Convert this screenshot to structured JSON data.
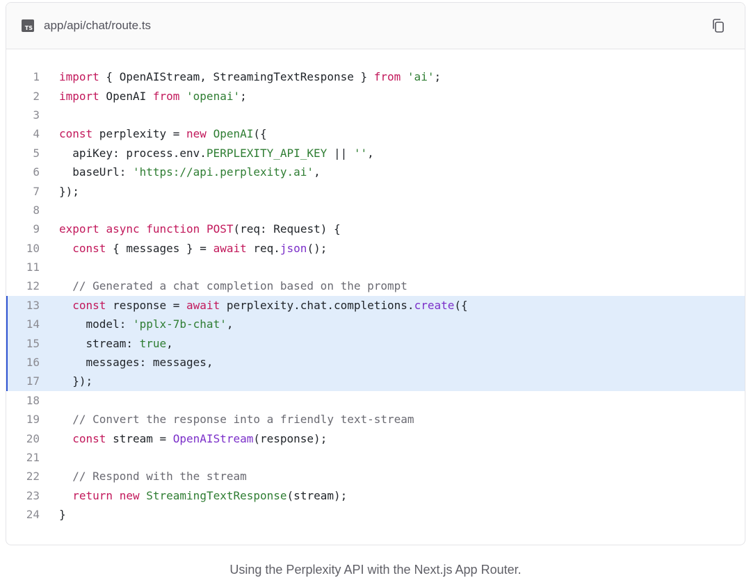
{
  "file": {
    "badge": "TS",
    "name": "app/api/chat/route.ts"
  },
  "copy_icon": "copy-icon",
  "highlight_lines": [
    13,
    14,
    15,
    16,
    17
  ],
  "code_lines": [
    {
      "n": "1",
      "tokens": [
        [
          "kw",
          "import"
        ],
        [
          "p",
          " { OpenAIStream, StreamingTextResponse } "
        ],
        [
          "kw",
          "from"
        ],
        [
          "p",
          " "
        ],
        [
          "str",
          "'ai'"
        ],
        [
          "p",
          ";"
        ]
      ]
    },
    {
      "n": "2",
      "tokens": [
        [
          "kw",
          "import"
        ],
        [
          "p",
          " OpenAI "
        ],
        [
          "kw",
          "from"
        ],
        [
          "p",
          " "
        ],
        [
          "str",
          "'openai'"
        ],
        [
          "p",
          ";"
        ]
      ]
    },
    {
      "n": "3",
      "tokens": []
    },
    {
      "n": "4",
      "tokens": [
        [
          "kw",
          "const"
        ],
        [
          "p",
          " perplexity = "
        ],
        [
          "kw",
          "new"
        ],
        [
          "p",
          " "
        ],
        [
          "cls",
          "OpenAI"
        ],
        [
          "p",
          "({"
        ]
      ]
    },
    {
      "n": "5",
      "tokens": [
        [
          "p",
          "  apiKey: process.env."
        ],
        [
          "cls",
          "PERPLEXITY_API_KEY"
        ],
        [
          "p",
          " || "
        ],
        [
          "str",
          "''"
        ],
        [
          "p",
          ","
        ]
      ]
    },
    {
      "n": "6",
      "tokens": [
        [
          "p",
          "  baseUrl: "
        ],
        [
          "str",
          "'https://api.perplexity.ai'"
        ],
        [
          "p",
          ","
        ]
      ]
    },
    {
      "n": "7",
      "tokens": [
        [
          "p",
          "});"
        ]
      ]
    },
    {
      "n": "8",
      "tokens": []
    },
    {
      "n": "9",
      "tokens": [
        [
          "kw",
          "export"
        ],
        [
          "p",
          " "
        ],
        [
          "kw",
          "async"
        ],
        [
          "p",
          " "
        ],
        [
          "kw",
          "function"
        ],
        [
          "p",
          " "
        ],
        [
          "kw",
          "POST"
        ],
        [
          "p",
          "(req: Request) {"
        ]
      ]
    },
    {
      "n": "10",
      "tokens": [
        [
          "p",
          "  "
        ],
        [
          "kw",
          "const"
        ],
        [
          "p",
          " { messages } = "
        ],
        [
          "kw",
          "await"
        ],
        [
          "p",
          " req."
        ],
        [
          "fn",
          "json"
        ],
        [
          "p",
          "();"
        ]
      ]
    },
    {
      "n": "11",
      "tokens": []
    },
    {
      "n": "12",
      "tokens": [
        [
          "cm",
          "  // Generated a chat completion based on the prompt"
        ]
      ]
    },
    {
      "n": "13",
      "tokens": [
        [
          "p",
          "  "
        ],
        [
          "kw",
          "const"
        ],
        [
          "p",
          " response = "
        ],
        [
          "kw",
          "await"
        ],
        [
          "p",
          " perplexity.chat.completions."
        ],
        [
          "fn",
          "create"
        ],
        [
          "p",
          "({"
        ]
      ]
    },
    {
      "n": "14",
      "tokens": [
        [
          "p",
          "    model: "
        ],
        [
          "str",
          "'pplx-7b-chat'"
        ],
        [
          "p",
          ","
        ]
      ]
    },
    {
      "n": "15",
      "tokens": [
        [
          "p",
          "    stream: "
        ],
        [
          "bool",
          "true"
        ],
        [
          "p",
          ","
        ]
      ]
    },
    {
      "n": "16",
      "tokens": [
        [
          "p",
          "    messages: messages,"
        ]
      ]
    },
    {
      "n": "17",
      "tokens": [
        [
          "p",
          "  });"
        ]
      ]
    },
    {
      "n": "18",
      "tokens": []
    },
    {
      "n": "19",
      "tokens": [
        [
          "cm",
          "  // Convert the response into a friendly text-stream"
        ]
      ]
    },
    {
      "n": "20",
      "tokens": [
        [
          "p",
          "  "
        ],
        [
          "kw",
          "const"
        ],
        [
          "p",
          " stream = "
        ],
        [
          "fn",
          "OpenAIStream"
        ],
        [
          "p",
          "(response);"
        ]
      ]
    },
    {
      "n": "21",
      "tokens": []
    },
    {
      "n": "22",
      "tokens": [
        [
          "cm",
          "  // Respond with the stream"
        ]
      ]
    },
    {
      "n": "23",
      "tokens": [
        [
          "p",
          "  "
        ],
        [
          "kw",
          "return"
        ],
        [
          "p",
          " "
        ],
        [
          "kw",
          "new"
        ],
        [
          "p",
          " "
        ],
        [
          "cls",
          "StreamingTextResponse"
        ],
        [
          "p",
          "(stream);"
        ]
      ]
    },
    {
      "n": "24",
      "tokens": [
        [
          "p",
          "}"
        ]
      ]
    }
  ],
  "caption": "Using the Perplexity API with the Next.js App Router."
}
